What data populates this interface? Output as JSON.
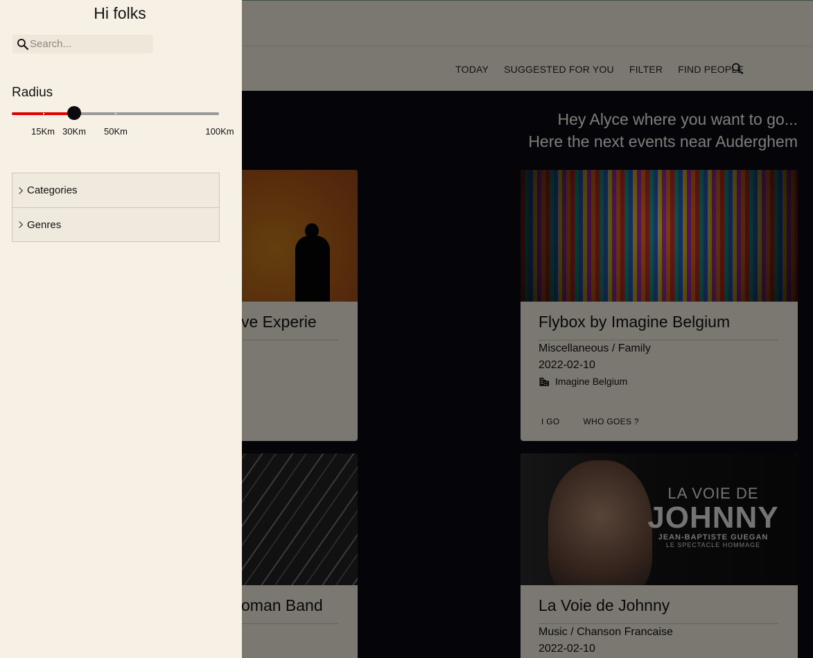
{
  "nav": {
    "items": [
      "TODAY",
      "SUGGESTED FOR YOU",
      "FILTER",
      "FIND PEOPLE"
    ],
    "search_icon": "search-icon"
  },
  "greeting": {
    "line1": "Hey Alyce where you want to go...",
    "line2": "Here the next events near Auderghem"
  },
  "cards": [
    {
      "title": "ve Experie"
    },
    {
      "title": "Flybox by Imagine Belgium",
      "category": "Miscellaneous / Family",
      "date": "2022-02-10",
      "organizer": "Imagine Belgium",
      "organizer_icon": "building-icon",
      "actions": [
        "I GO",
        "WHO GOES ?"
      ]
    },
    {
      "title": "oman Band"
    },
    {
      "title": "La Voie de Johnny",
      "category": "Music / Chanson Francaise",
      "date": "2022-02-10",
      "poster": {
        "line1": "LA VOIE DE",
        "line2": "JOHNNY",
        "line3": "JEAN-BAPTISTE GUEGAN",
        "line4": "LE SPECTACLE HOMMAGE"
      }
    }
  ],
  "drawer": {
    "title": "Hi folks",
    "search": {
      "placeholder": "Search...",
      "value": ""
    },
    "radius": {
      "label": "Radius",
      "value_km": 30,
      "marks": [
        "15Km",
        "30Km",
        "50Km",
        "100Km"
      ]
    },
    "accordion": [
      "Categories",
      "Genres"
    ]
  },
  "colors": {
    "drawer_bg": "#f7f0e4",
    "slider_active": "#e10000",
    "slider_thumb": "#0b0b0f"
  }
}
